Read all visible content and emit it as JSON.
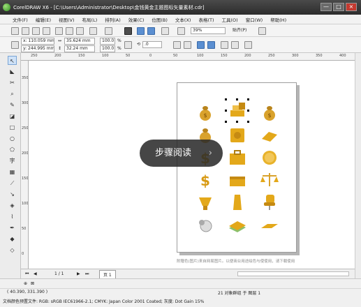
{
  "window": {
    "title": "CorelDRAW X6 - [C:\\Users\\Administrator\\Desktop\\金钱黄金主题图标矢量素材.cdr]",
    "controls": [
      "—",
      "□",
      "×"
    ]
  },
  "menu": [
    "文件(F)",
    "编辑(E)",
    "视图(V)",
    "布局(L)",
    "排列(A)",
    "效果(C)",
    "位图(B)",
    "文本(X)",
    "表格(T)",
    "工具(O)",
    "窗口(W)",
    "帮助(H)"
  ],
  "toolbar": {
    "zoom": "39%",
    "snap": "贴齐(P)"
  },
  "property_bar": {
    "x": "x: 110.059 mm",
    "y": "y: 244.995 mm",
    "width": "35.624 mm",
    "height": "32.24 mm",
    "scale_x": "100.0",
    "scale_y": "100.0",
    "percent": "%",
    "angle": ".0"
  },
  "ruler": {
    "h_marks": [
      "250",
      "200",
      "150",
      "100",
      "50",
      "0",
      "50",
      "100",
      "150",
      "200",
      "250",
      "300",
      "350",
      "400"
    ],
    "v_marks": [
      "350",
      "300",
      "250",
      "200",
      "150",
      "100",
      "50",
      "0"
    ]
  },
  "page_nav": {
    "current": "1 / 1",
    "tab": "页 1"
  },
  "overlay": {
    "label": "步骤阅读",
    "chevron": "›"
  },
  "watermark": "附赠色(图片)来自网易图片。以便商业用途绘色与使使用，请下载使用",
  "status": {
    "coords": "( 40.390, 331.390 )",
    "selection": "21 对象群组 于 图层 1",
    "color_profile": "文档颜色预置文件: RGB: sRGB IEC61966-2.1; CMYK: Japan Color 2001 Coated; 灰度: Dot Gain 15%"
  },
  "colors": {
    "gold": "#e3a81a",
    "title_bg": "#3a3a3a"
  },
  "icons": [
    "money-bag-icon",
    "gold-bars-icon",
    "money-bag-icon",
    "money-bag-icon",
    "safe-box-icon",
    "gold-coin-icon",
    "dollar-sign-icon",
    "briefcase-icon",
    "gold-coin-icon",
    "dollar-sign-icon",
    "gold-briefcase-icon",
    "balance-scale-icon",
    "trophy-icon",
    "gold-bar-icon",
    "office-chair-icon",
    "stopwatch-icon",
    "cash-stack-icon",
    "gold-bar-flat-icon"
  ]
}
